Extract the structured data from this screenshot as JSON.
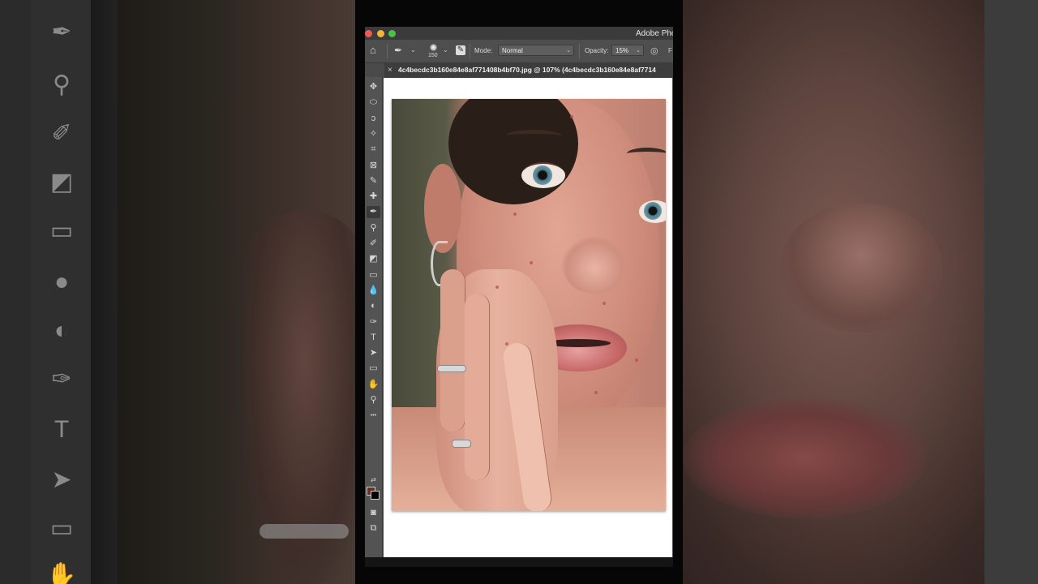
{
  "app": {
    "title": "Adobe Pho"
  },
  "options_bar": {
    "brush_size": "150",
    "mode_label": "Mode:",
    "mode_value": "Normal",
    "opacity_label": "Opacity:",
    "opacity_value": "15%",
    "trailing_label": "F"
  },
  "document": {
    "tab_title": "4c4becdc3b160e84e8af771408b4bf70.jpg @ 107% (4c4becdc3b160e84e8af7714"
  },
  "colors": {
    "foreground": "#6b2f22",
    "background": "#000000",
    "chrome": "#4a4a4a"
  },
  "tools": [
    {
      "name": "move-tool-icon",
      "glyph": "✥"
    },
    {
      "name": "marquee-tool-icon",
      "glyph": "⬭"
    },
    {
      "name": "lasso-tool-icon",
      "glyph": "ↄ"
    },
    {
      "name": "magic-wand-tool-icon",
      "glyph": "✧"
    },
    {
      "name": "crop-tool-icon",
      "glyph": "⌗"
    },
    {
      "name": "frame-tool-icon",
      "glyph": "⊠"
    },
    {
      "name": "eyedropper-tool-icon",
      "glyph": "✎"
    },
    {
      "name": "healing-brush-tool-icon",
      "glyph": "✚"
    },
    {
      "name": "brush-tool-icon",
      "glyph": "✒"
    },
    {
      "name": "clone-stamp-tool-icon",
      "glyph": "⚲"
    },
    {
      "name": "history-brush-tool-icon",
      "glyph": "✐"
    },
    {
      "name": "eraser-tool-icon",
      "glyph": "◩"
    },
    {
      "name": "gradient-tool-icon",
      "glyph": "▭"
    },
    {
      "name": "blur-tool-icon",
      "glyph": "💧"
    },
    {
      "name": "dodge-tool-icon",
      "glyph": "◐"
    },
    {
      "name": "pen-tool-icon",
      "glyph": "✑"
    },
    {
      "name": "type-tool-icon",
      "glyph": "T"
    },
    {
      "name": "path-selection-tool-icon",
      "glyph": "➤"
    },
    {
      "name": "rectangle-tool-icon",
      "glyph": "▭"
    },
    {
      "name": "hand-tool-icon",
      "glyph": "✋"
    },
    {
      "name": "zoom-tool-icon",
      "glyph": "⚲"
    },
    {
      "name": "more-tools-icon",
      "glyph": "•••"
    }
  ]
}
